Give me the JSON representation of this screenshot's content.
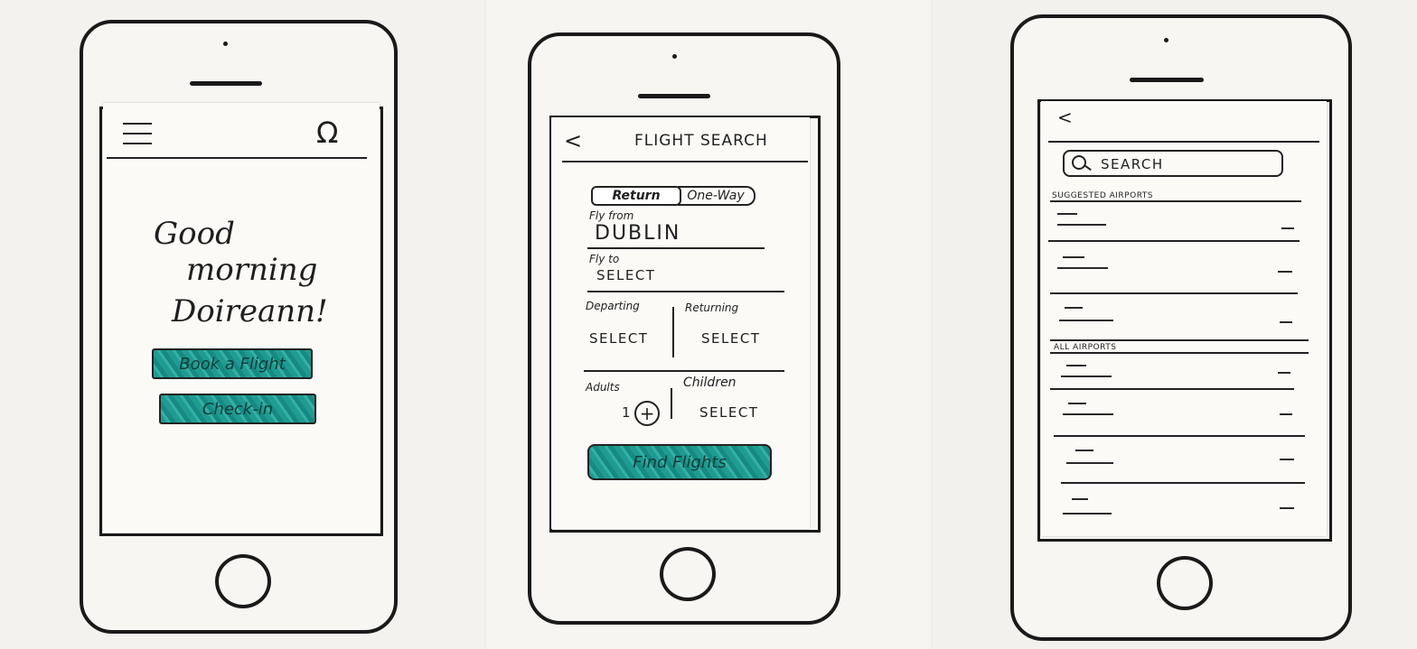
{
  "screen1": {
    "greeting_line1": "Good",
    "greeting_line2": "morning",
    "greeting_line3": "Doireann!",
    "book_flight_label": "Book a Flight",
    "check_in_label": "Check-in",
    "profile_icon_glyph": "Ω",
    "accent_color": "#1f9b92"
  },
  "screen2": {
    "back_glyph": "<",
    "title": "FLIGHT SEARCH",
    "trip_types": [
      "Return",
      "One-Way"
    ],
    "selected_trip_type": "Return",
    "fly_from_label": "Fly from",
    "fly_from_value": "DUBLIN",
    "fly_to_label": "Fly to",
    "fly_to_value": "SELECT",
    "departing_label": "Departing",
    "departing_value": "SELECT",
    "returning_label": "Returning",
    "returning_value": "SELECT",
    "adults_label": "Adults",
    "adults_value": "1",
    "plus_glyph": "+",
    "children_label": "Children",
    "children_value": "SELECT",
    "find_flights_label": "Find Flights"
  },
  "screen3": {
    "back_glyph": "<",
    "search_placeholder": "SEARCH",
    "suggested_heading": "SUGGESTED AIRPORTS",
    "all_heading": "ALL AIRPORTS"
  }
}
